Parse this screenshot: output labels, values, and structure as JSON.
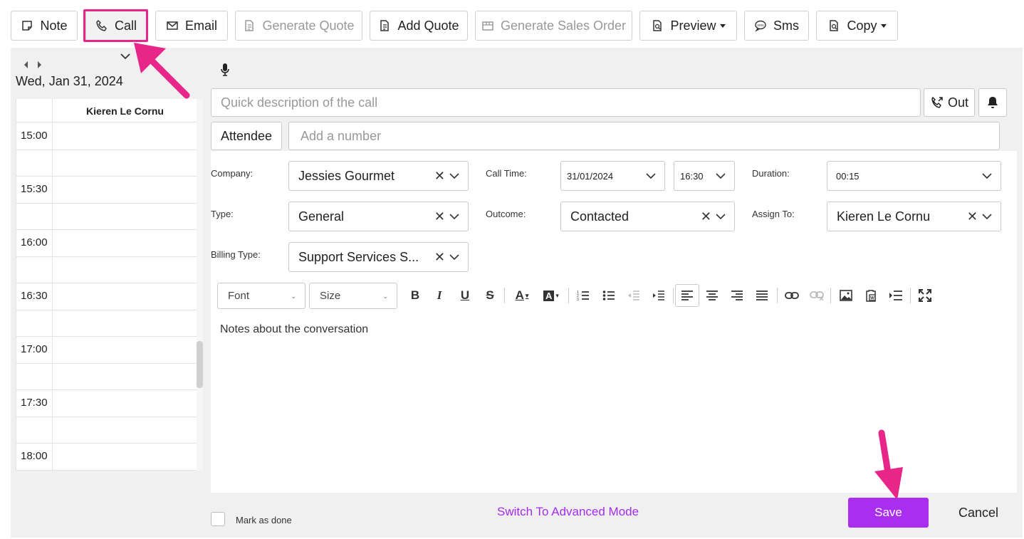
{
  "toolbar": {
    "note": "Note",
    "call": "Call",
    "email": "Email",
    "generate_quote": "Generate Quote",
    "add_quote": "Add Quote",
    "generate_sales_order": "Generate Sales Order",
    "preview": "Preview",
    "sms": "Sms",
    "copy": "Copy"
  },
  "calendar": {
    "date": "Wed, Jan 31, 2024",
    "column_header": "Kieren Le Cornu",
    "times": [
      "15:00",
      "15:30",
      "16:00",
      "16:30",
      "17:00",
      "17:30",
      "18:00"
    ]
  },
  "form": {
    "description_placeholder": "Quick description of the call",
    "out_label": "Out",
    "attendee_label": "Attendee",
    "number_placeholder": "Add a number",
    "company_label": "Company:",
    "company_value": "Jessies Gourmet",
    "call_time_label": "Call Time:",
    "call_date": "31/01/2024",
    "call_time": "16:30",
    "duration_label": "Duration:",
    "duration_value": "00:15",
    "type_label": "Type:",
    "type_value": "General",
    "outcome_label": "Outcome:",
    "outcome_value": "Contacted",
    "assign_label": "Assign To:",
    "assign_value": "Kieren Le Cornu",
    "billing_label": "Billing Type:",
    "billing_value": "Support Services S..."
  },
  "editor": {
    "font_label": "Font",
    "size_label": "Size",
    "content": "Notes about the conversation"
  },
  "footer": {
    "mark_done": "Mark as done",
    "switch_mode": "Switch To Advanced Mode",
    "save": "Save",
    "cancel": "Cancel"
  },
  "colors": {
    "accent": "#a92ef0",
    "highlight": "#e8268a"
  }
}
